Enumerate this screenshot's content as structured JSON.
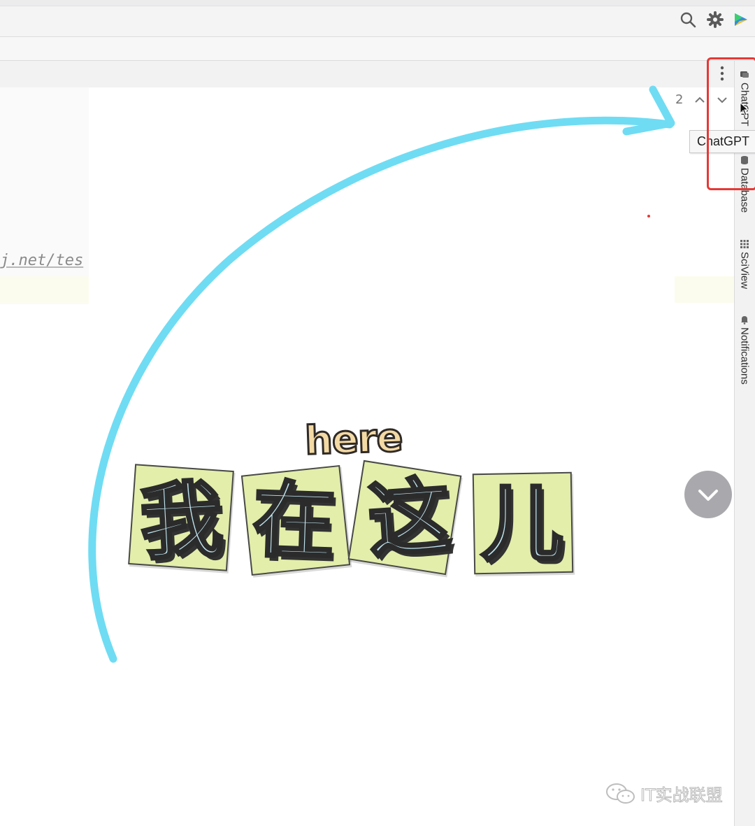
{
  "toolbar": {
    "icons": [
      "search-icon",
      "gear-icon",
      "plugin-logo-icon"
    ]
  },
  "editor": {
    "code_fragment": "j.net/tes"
  },
  "find": {
    "match_count": "2"
  },
  "tool_strip": {
    "tabs": [
      {
        "label": "ChatGPT",
        "icon": "chat-bubble-icon"
      },
      {
        "label": "Database",
        "icon": "database-icon"
      },
      {
        "label": "SciView",
        "icon": "grid-icon"
      },
      {
        "label": "Notifications",
        "icon": "bell-icon"
      }
    ],
    "tooltip": "ChatGPT"
  },
  "overlay": {
    "here": "here",
    "chars": [
      "我",
      "在",
      "这",
      "儿"
    ],
    "arrow_color": "#6fdcf3",
    "tile_color": "#e2eeaa",
    "char_color": "#bfe3ee"
  },
  "watermark": {
    "text": "IT实战联盟"
  }
}
